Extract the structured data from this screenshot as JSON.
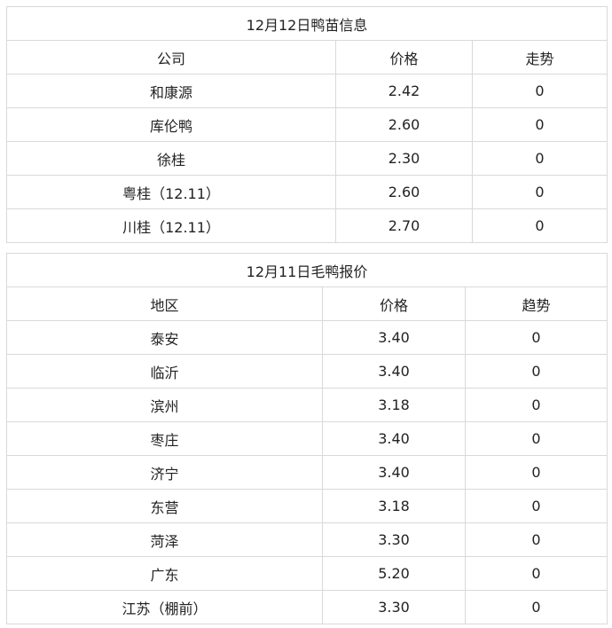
{
  "duckling_table": {
    "title": "12月12日鸭苗信息",
    "headers": [
      "公司",
      "价格",
      "走势"
    ],
    "rows": [
      [
        "和康源",
        "2.42",
        "0"
      ],
      [
        "库伦鸭",
        "2.60",
        "0"
      ],
      [
        "徐桂",
        "2.30",
        "0"
      ],
      [
        "粤桂（12.11）",
        "2.60",
        "0"
      ],
      [
        "川桂（12.11）",
        "2.70",
        "0"
      ]
    ]
  },
  "duck_table": {
    "title": "12月11日毛鸭报价",
    "headers": [
      "地区",
      "价格",
      "趋势"
    ],
    "rows": [
      [
        "泰安",
        "3.40",
        "0"
      ],
      [
        "临沂",
        "3.40",
        "0"
      ],
      [
        "滨州",
        "3.18",
        "0"
      ],
      [
        "枣庄",
        "3.40",
        "0"
      ],
      [
        "济宁",
        "3.40",
        "0"
      ],
      [
        "东营",
        "3.18",
        "0"
      ],
      [
        "菏泽",
        "3.30",
        "0"
      ],
      [
        "广东",
        "5.20",
        "0"
      ],
      [
        "江苏（棚前）",
        "3.30",
        "0"
      ]
    ]
  }
}
